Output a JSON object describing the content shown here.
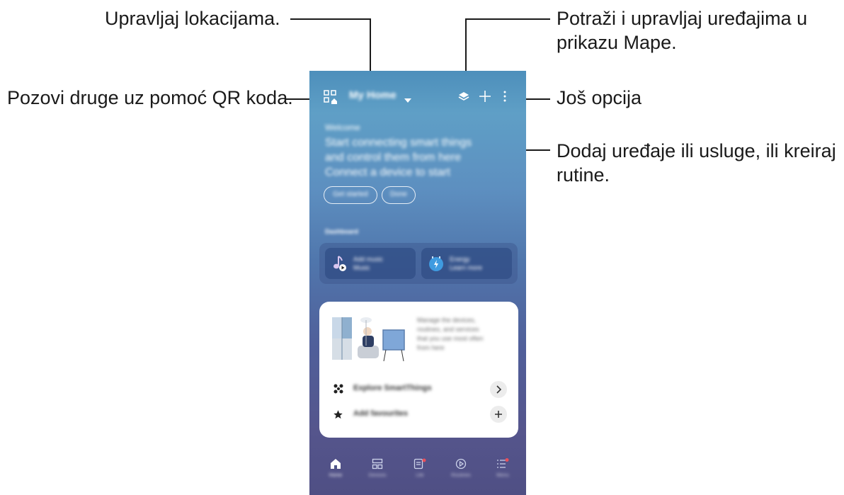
{
  "callouts": {
    "manage_locations": "Upravljaj lokacijama.",
    "invite_qr": "Pozovi druge uz pomoć QR koda.",
    "map_view_line1": "Potraži i upravljaj uređajima u",
    "map_view_line2": "prikazu Mape.",
    "more_options": "Još opcija",
    "add_devices_line1": "Dodaj uređaje ili usluge, ili kreiraj",
    "add_devices_line2": "rutine."
  },
  "phone": {
    "location_name": "My Home",
    "welcome": {
      "title": "Welcome",
      "line1": "Start connecting smart things",
      "line2": "and control them from here",
      "line3": "Connect a device to start"
    },
    "buttons": {
      "get_started": "Get started",
      "done": "Done"
    },
    "dashboard_label": "Dashboard",
    "tiles": [
      {
        "icon": "music-note-icon",
        "title": "Add music",
        "subtitle": "Music"
      },
      {
        "icon": "energy-icon",
        "title": "Energy",
        "subtitle": "Learn more"
      }
    ],
    "promo_text": {
      "line1": "Manage the devices,",
      "line2": "routines, and services",
      "line3": "that you use most often",
      "line4": "from here"
    },
    "list_items": [
      {
        "icon": "smartthings-icon",
        "label": "Explore SmartThings",
        "action": "chevron-right-icon"
      },
      {
        "icon": "star-icon",
        "label": "Add favourites",
        "action": "plus-icon"
      }
    ],
    "nav": [
      {
        "icon": "home-icon",
        "label": "Home"
      },
      {
        "icon": "devices-icon",
        "label": "Devices"
      },
      {
        "icon": "life-icon",
        "label": "Life"
      },
      {
        "icon": "routines-icon",
        "label": "Routines"
      },
      {
        "icon": "menu-icon",
        "label": "Menu"
      }
    ]
  }
}
